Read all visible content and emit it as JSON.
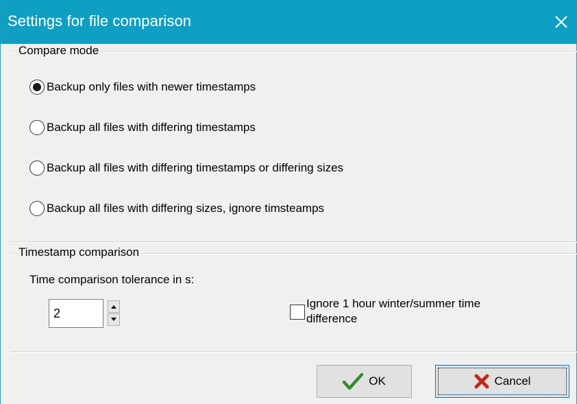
{
  "window": {
    "title": "Settings for file comparison",
    "close_symbol": "✕"
  },
  "compare_mode": {
    "legend": "Compare mode",
    "options": [
      {
        "label": "Backup only files with newer timestamps",
        "selected": true
      },
      {
        "label": "Backup all files with differing timestamps",
        "selected": false
      },
      {
        "label": "Backup all files with differing timestamps or differing sizes",
        "selected": false
      },
      {
        "label": "Backup all files with differing sizes, ignore timsteamps",
        "selected": false
      }
    ]
  },
  "timestamp_comparison": {
    "legend": "Timestamp comparison",
    "tolerance_label": "Time comparison tolerance in s:",
    "tolerance_value": "2",
    "ignore_dst_line1": "Ignore 1 hour winter/summer time",
    "ignore_dst_line2": "difference",
    "ignore_dst_checked": false
  },
  "buttons": {
    "ok_label": "OK",
    "cancel_label": "Cancel"
  },
  "colors": {
    "titlebar": "#0f9fc2",
    "ok_check": "#2e8b2e",
    "cancel_x": "#c0281e"
  },
  "icons": {
    "close": "close-icon",
    "ok": "checkmark-icon",
    "cancel": "cross-icon",
    "spin_up": "arrow-up-icon",
    "spin_down": "arrow-down-icon"
  }
}
